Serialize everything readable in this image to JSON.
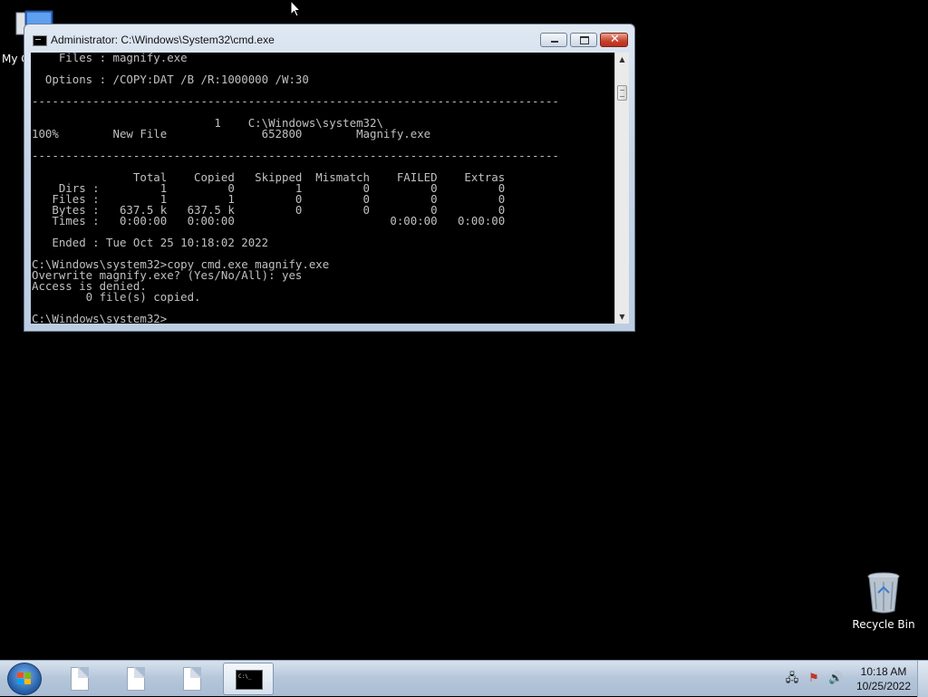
{
  "desktop": {
    "icons": [
      {
        "label": "My C"
      },
      {
        "label": "Recycle Bin"
      }
    ]
  },
  "window": {
    "title": "Administrator: C:\\Windows\\System32\\cmd.exe",
    "console_lines": [
      "    Files : magnify.exe",
      "",
      "  Options : /COPY:DAT /B /R:1000000 /W:30",
      "",
      "------------------------------------------------------------------------------",
      "",
      "                           1    C:\\Windows\\system32\\",
      "100%        New File              652800        Magnify.exe",
      "",
      "------------------------------------------------------------------------------",
      "",
      "               Total    Copied   Skipped  Mismatch    FAILED    Extras",
      "    Dirs :         1         0         1         0         0         0",
      "   Files :         1         1         0         0         0         0",
      "   Bytes :   637.5 k   637.5 k         0         0         0         0",
      "   Times :   0:00:00   0:00:00                       0:00:00   0:00:00",
      "",
      "   Ended : Tue Oct 25 10:18:02 2022",
      "",
      "C:\\Windows\\system32>copy cmd.exe magnify.exe",
      "Overwrite magnify.exe? (Yes/No/All): yes",
      "Access is denied.",
      "        0 file(s) copied.",
      "",
      "C:\\Windows\\system32>"
    ]
  },
  "taskbar": {
    "time": "10:18 AM",
    "date": "10/25/2022",
    "cmd_icon_text": "C:\\_"
  }
}
